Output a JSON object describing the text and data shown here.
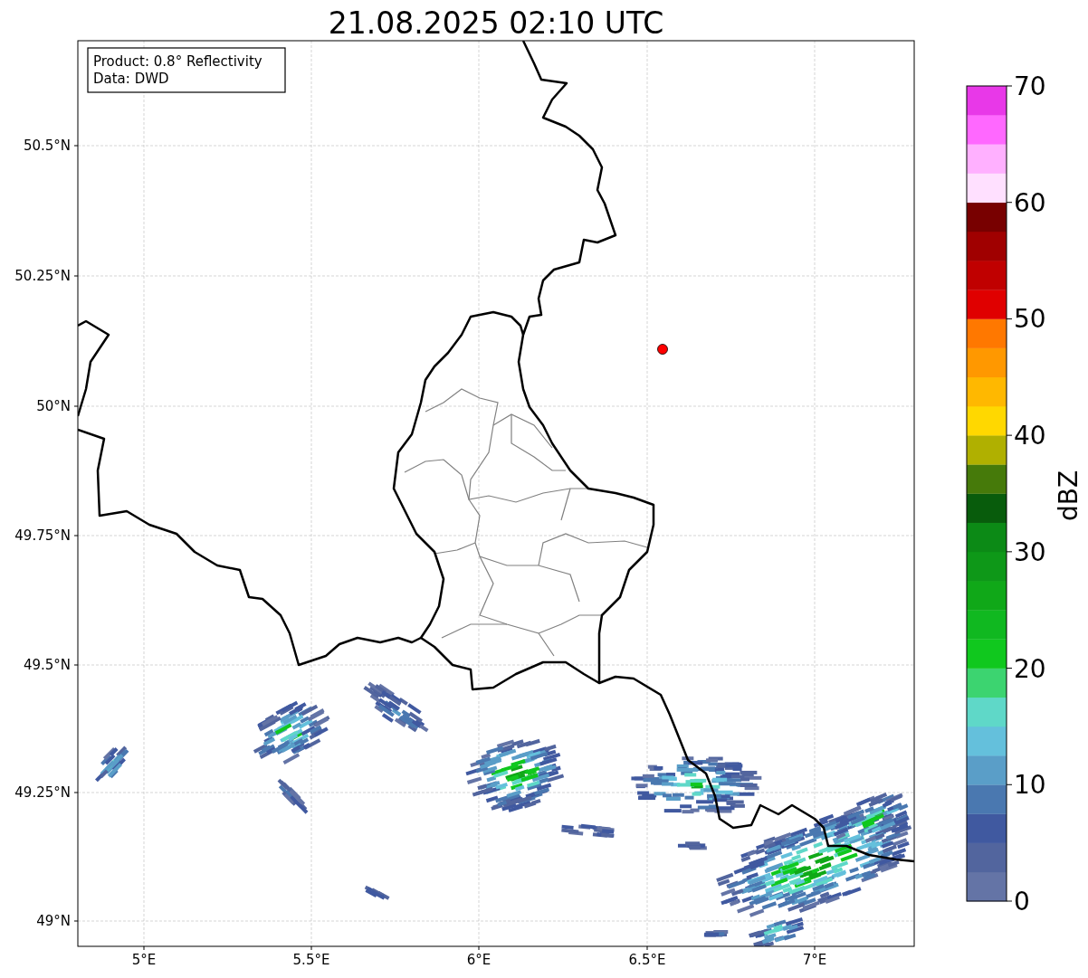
{
  "title": "21.08.2025 02:10 UTC",
  "info_box": [
    "Product: 0.8° Reflectivity",
    "Data: DWD"
  ],
  "y_axis": {
    "ticks": [
      "50.5°N",
      "50.25°N",
      "50°N",
      "49.75°N",
      "49.5°N",
      "49.25°N",
      "49°N"
    ]
  },
  "x_axis": {
    "ticks": [
      "5°E",
      "5.5°E",
      "6°E",
      "6.5°E",
      "7°E"
    ]
  },
  "colorbar": {
    "label": "dBZ",
    "ticks": [
      "70",
      "60",
      "50",
      "40",
      "30",
      "20",
      "10",
      "0"
    ],
    "bins": [
      {
        "color": "#6474a6"
      },
      {
        "color": "#52659e"
      },
      {
        "color": "#4059a0"
      },
      {
        "color": "#4a78b0"
      },
      {
        "color": "#5a9ec8"
      },
      {
        "color": "#64c0dc"
      },
      {
        "color": "#5fd8c8"
      },
      {
        "color": "#3cd470"
      },
      {
        "color": "#10c81e"
      },
      {
        "color": "#10b820"
      },
      {
        "color": "#10a818"
      },
      {
        "color": "#0e9818"
      },
      {
        "color": "#0c8a16"
      },
      {
        "color": "#085c0c"
      },
      {
        "color": "#467a0a"
      },
      {
        "color": "#b0b000"
      },
      {
        "color": "#ffd800"
      },
      {
        "color": "#ffb800"
      },
      {
        "color": "#ff9800"
      },
      {
        "color": "#ff7800"
      },
      {
        "color": "#e00000"
      },
      {
        "color": "#c00000"
      },
      {
        "color": "#a00000"
      },
      {
        "color": "#780000"
      },
      {
        "color": "#ffe0ff"
      },
      {
        "color": "#ffb0ff"
      },
      {
        "color": "#ff68ff"
      },
      {
        "color": "#e838e8"
      }
    ]
  }
}
